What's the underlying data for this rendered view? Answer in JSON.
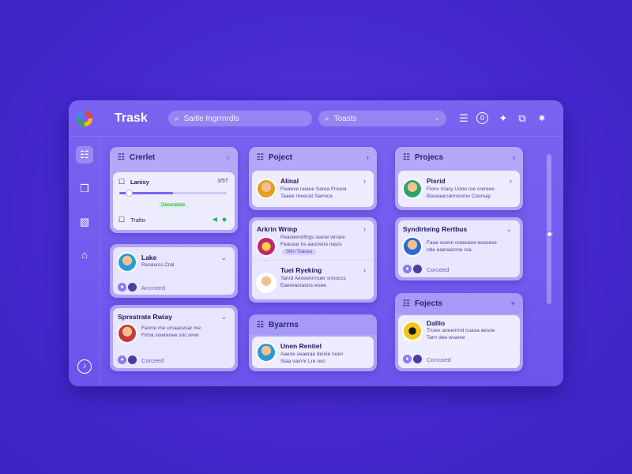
{
  "header": {
    "title": "Trask",
    "search_text": "Saitle Ingrrnrdls",
    "filter_text": "Toasts"
  },
  "columns": [
    {
      "header": "Crerlet",
      "header_icon": "clipboard-icon",
      "cards": [
        {
          "title": "Lanisy",
          "meta": "3/5T",
          "progress": 0.5,
          "badge": "Deesrakkte",
          "extra": "Tralto"
        },
        {
          "title": "Lake",
          "subtitle": "Reoavrcs Cral",
          "footer": "Arcrceed"
        },
        {
          "title": "Sprestrate Rwiay",
          "subtitle": "Fanrre rne urcaacesar me\nFrrna sowrenee snc rerer",
          "footer": "Corceed"
        }
      ]
    },
    {
      "header": "Poject",
      "header_icon": "clipboard-icon",
      "cards": [
        {
          "title": "Alinal",
          "subtitle": "Fleaeve raiaue Sarea Fnseia\nTaaee rneecat Sarreca"
        },
        {
          "title": "Arkrin Wrinp",
          "subtitle": "Peaceerorfirgs seese wrrare\nFeacear irs earcreno nasrs",
          "badge": "Stlrs Toacea"
        },
        {
          "title": "Tuei Ryeking",
          "subtitle": "Tanrd Aeceenrrnuer snnoccs\nEaereaoraiurs wsee"
        },
        {
          "header": "Byarrns"
        },
        {
          "title": "Unen Rentiel",
          "subtitle": "Aaene veaerae deinie noen\nStaa vamnr Lre recr"
        }
      ]
    },
    {
      "header": "Projecs",
      "header_icon": "clipboard-icon",
      "cards": [
        {
          "title": "Pisrid",
          "subtitle": "Fionv rnasy Uone roe crereee\nBaseaarcanrresme Coorsay"
        },
        {
          "title": "Syndirteing Rertbus",
          "subtitle": "Faue ocenn rceecane ecesese\nnbe eaeraarsne roa"
        },
        {
          "header": "Fojects"
        },
        {
          "title": "Dallio",
          "subtitle": "Tnsex aoeemrrd cuaoa aesoe\nTarrr dee wsaree",
          "footer": "Corrcoed"
        }
      ]
    }
  ],
  "colors": {
    "accent": "#6b54ec",
    "background": "#4628cf",
    "card": "#eeecff"
  }
}
